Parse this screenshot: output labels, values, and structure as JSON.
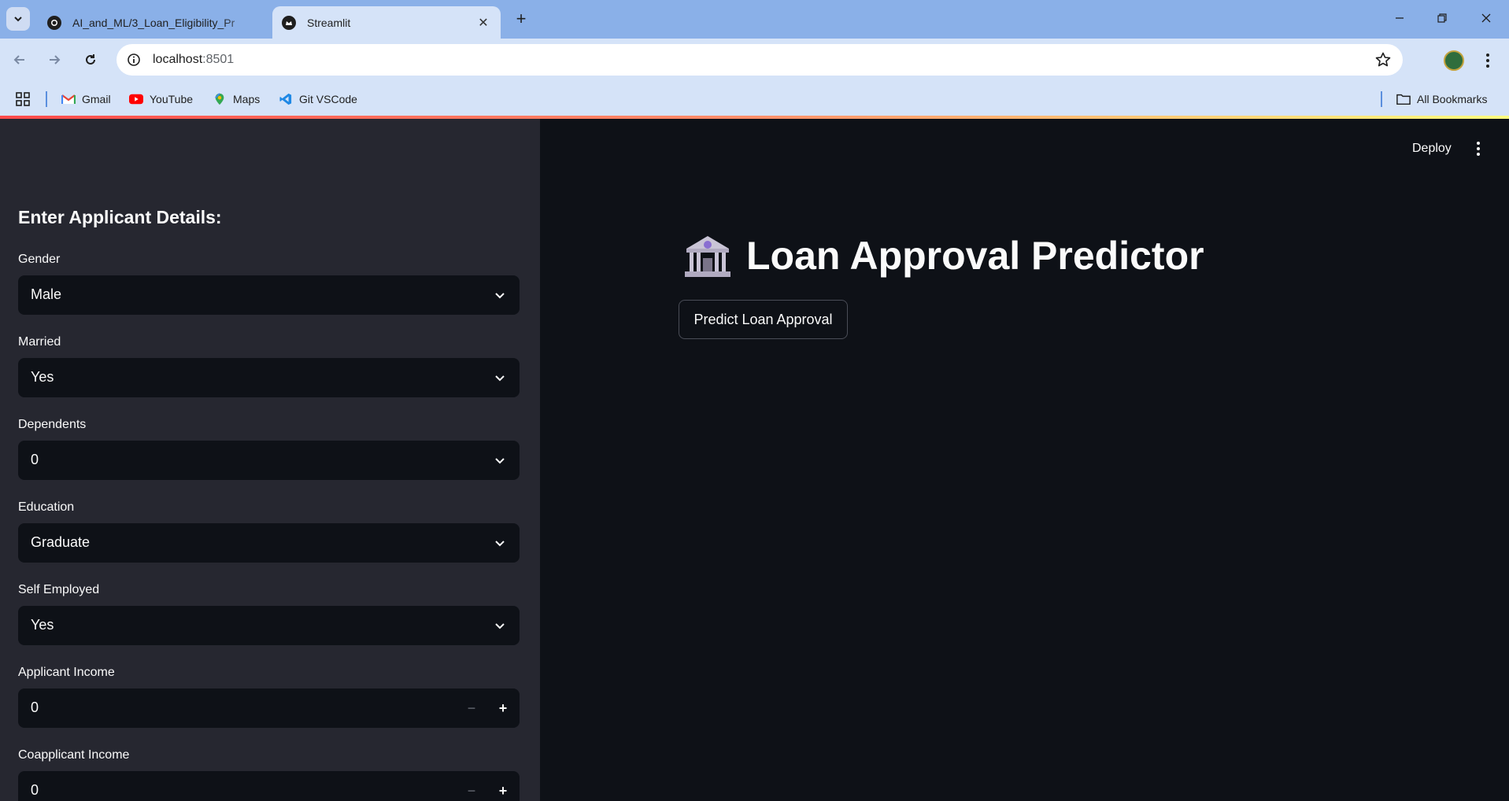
{
  "browser": {
    "tabs": [
      {
        "title": "AI_and_ML/3_Loan_Eligibility_Pr",
        "active": false
      },
      {
        "title": "Streamlit",
        "active": true
      }
    ],
    "url_host": "localhost",
    "url_port": ":8501",
    "bookmarks": [
      "Gmail",
      "YouTube",
      "Maps",
      "Git VSCode"
    ],
    "all_bookmarks": "All Bookmarks"
  },
  "app": {
    "deploy_label": "Deploy",
    "title": "Loan Approval Predictor",
    "title_icon": "bank-icon",
    "predict_button": "Predict Loan Approval",
    "sidebar": {
      "header": "Enter Applicant Details:",
      "fields": [
        {
          "label": "Gender",
          "type": "select",
          "value": "Male"
        },
        {
          "label": "Married",
          "type": "select",
          "value": "Yes"
        },
        {
          "label": "Dependents",
          "type": "select",
          "value": "0"
        },
        {
          "label": "Education",
          "type": "select",
          "value": "Graduate"
        },
        {
          "label": "Self Employed",
          "type": "select",
          "value": "Yes"
        },
        {
          "label": "Applicant Income",
          "type": "number",
          "value": "0",
          "minus": "−",
          "plus": "+"
        },
        {
          "label": "Coapplicant Income",
          "type": "number",
          "value": "0",
          "minus": "−",
          "plus": "+"
        }
      ]
    }
  },
  "colors": {
    "sidebar_bg": "#262730",
    "main_bg": "#0e1117",
    "text": "#fafafa",
    "chrome_tabbar": "#8ab0e8",
    "chrome_toolbar": "#d5e3f8"
  }
}
